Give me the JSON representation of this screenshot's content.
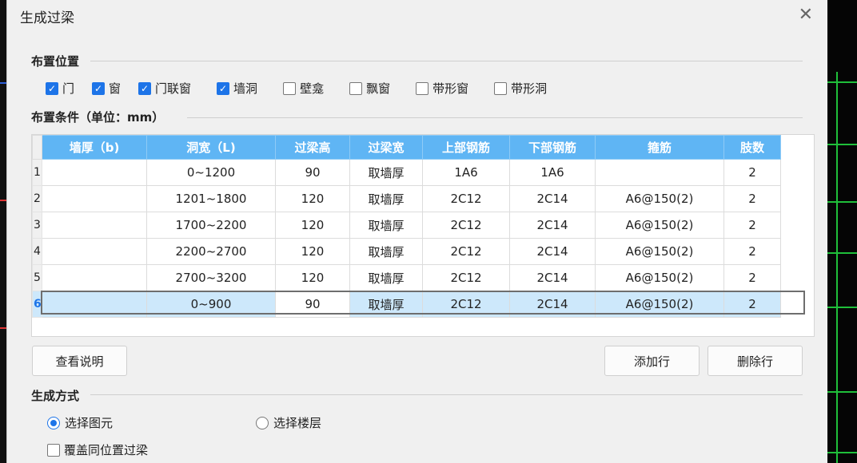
{
  "dialog": {
    "title": "生成过梁",
    "close_glyph": "✕"
  },
  "placement": {
    "label": "布置位置",
    "options": [
      {
        "label": "门",
        "checked": true
      },
      {
        "label": "窗",
        "checked": true
      },
      {
        "label": "门联窗",
        "checked": true
      },
      {
        "label": "墙洞",
        "checked": true
      },
      {
        "label": "壁龛",
        "checked": false
      },
      {
        "label": "飘窗",
        "checked": false
      },
      {
        "label": "带形窗",
        "checked": false
      },
      {
        "label": "带形洞",
        "checked": false
      }
    ]
  },
  "conditions": {
    "label": "布置条件（单位：mm）",
    "headers": [
      "墙厚（b)",
      "洞宽（L)",
      "过梁高",
      "过梁宽",
      "上部钢筋",
      "下部钢筋",
      "箍筋",
      "肢数"
    ],
    "rows": [
      {
        "idx": "1",
        "cells": [
          "",
          "0~1200",
          "90",
          "取墙厚",
          "1A6",
          "1A6",
          "",
          "2"
        ]
      },
      {
        "idx": "2",
        "cells": [
          "",
          "1201~1800",
          "120",
          "取墙厚",
          "2C12",
          "2C14",
          "A6@150(2)",
          "2"
        ]
      },
      {
        "idx": "3",
        "cells": [
          "",
          "1700~2200",
          "120",
          "取墙厚",
          "2C12",
          "2C14",
          "A6@150(2)",
          "2"
        ]
      },
      {
        "idx": "4",
        "cells": [
          "",
          "2200~2700",
          "120",
          "取墙厚",
          "2C12",
          "2C14",
          "A6@150(2)",
          "2"
        ]
      },
      {
        "idx": "5",
        "cells": [
          "",
          "2700~3200",
          "120",
          "取墙厚",
          "2C12",
          "2C14",
          "A6@150(2)",
          "2"
        ]
      },
      {
        "idx": "6",
        "cells": [
          "",
          "0~900",
          "90",
          "取墙厚",
          "2C12",
          "2C14",
          "A6@150(2)",
          "2"
        ]
      }
    ],
    "selected_row": 5,
    "active_cell": 2
  },
  "buttons": {
    "view_help": "查看说明",
    "add_row": "添加行",
    "delete_row": "删除行"
  },
  "generation": {
    "label": "生成方式",
    "select_element": "选择图元",
    "select_floor": "选择楼层",
    "selected": "select_element",
    "overwrite_label": "覆盖同位置过梁",
    "overwrite_checked": false
  },
  "colors": {
    "accent": "#1d74e8",
    "header": "#5fb5f4",
    "selected_row": "#cde8fb",
    "grid_green": "#1fbf3a"
  }
}
